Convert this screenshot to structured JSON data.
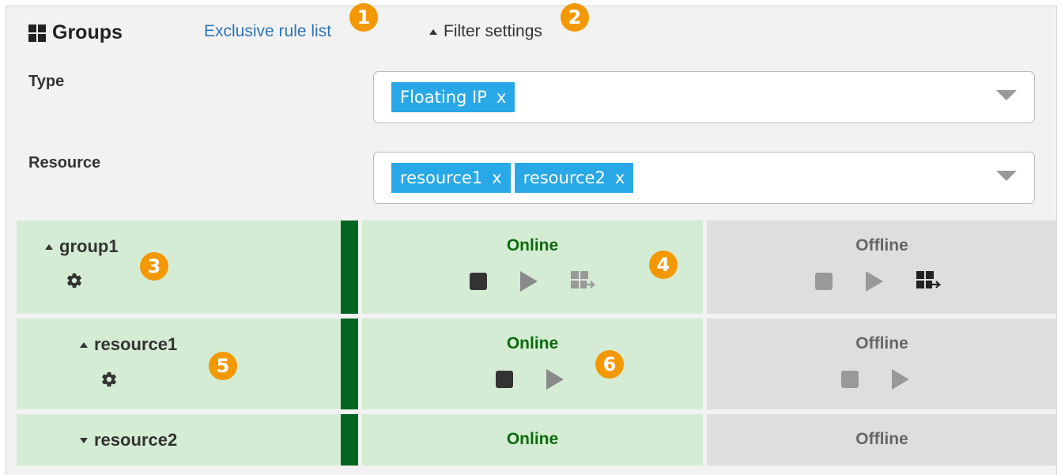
{
  "header": {
    "title": "Groups",
    "exclusive_rule_link": "Exclusive rule list",
    "filter_toggle": "Filter settings"
  },
  "badges": [
    "1",
    "2",
    "3",
    "4",
    "5",
    "6"
  ],
  "filters": {
    "type": {
      "label": "Type",
      "chips": [
        "Floating IP"
      ]
    },
    "resource": {
      "label": "Resource",
      "chips": [
        "resource1",
        "resource2"
      ]
    },
    "chip_remove": "x"
  },
  "rows": [
    {
      "name": "group1",
      "expanded": true,
      "online": "Online",
      "offline": "Offline"
    },
    {
      "name": "resource1",
      "expanded": true,
      "online": "Online",
      "offline": "Offline"
    },
    {
      "name": "resource2",
      "expanded": false,
      "online": "Online",
      "offline": "Offline"
    }
  ],
  "colors": {
    "online_bg": "#d4ecd4",
    "offline_bg": "#dedede",
    "status_bar": "#006620",
    "chip": "#29a8e8",
    "badge": "#f39800",
    "link": "#2e74b5"
  },
  "icons": {
    "stop": "stop-icon",
    "start": "play-icon",
    "move": "move-group-icon",
    "settings": "gear-icon"
  }
}
